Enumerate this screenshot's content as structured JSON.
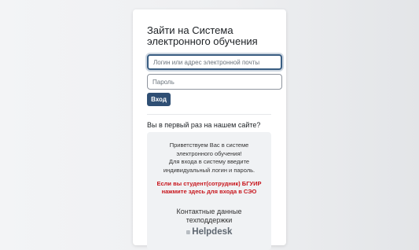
{
  "login": {
    "title": "Зайти на Система электронного обучения",
    "username_placeholder": "Логин или адрес электронной почты",
    "password_placeholder": "Пароль",
    "submit_label": "Вход"
  },
  "first_time": {
    "heading": "Вы в первый раз на нашем сайте?",
    "welcome_line1": "Приветствуем Вас в системе",
    "welcome_line2": "электронного обучения!",
    "welcome_line3": "Для входа в систему введите",
    "welcome_line4": "индивидуальный логин и пароль.",
    "student_line1": "Если вы студент(сотрудник) БГУИР",
    "student_line2": "нажмите здесь для входа в СЭО",
    "contacts_line1": "Контактные данные",
    "contacts_line2": "техподдержки",
    "helpdesk_label": "Helpdesk"
  },
  "colors": {
    "accent": "#2f4f74",
    "alert": "#c8161d"
  }
}
